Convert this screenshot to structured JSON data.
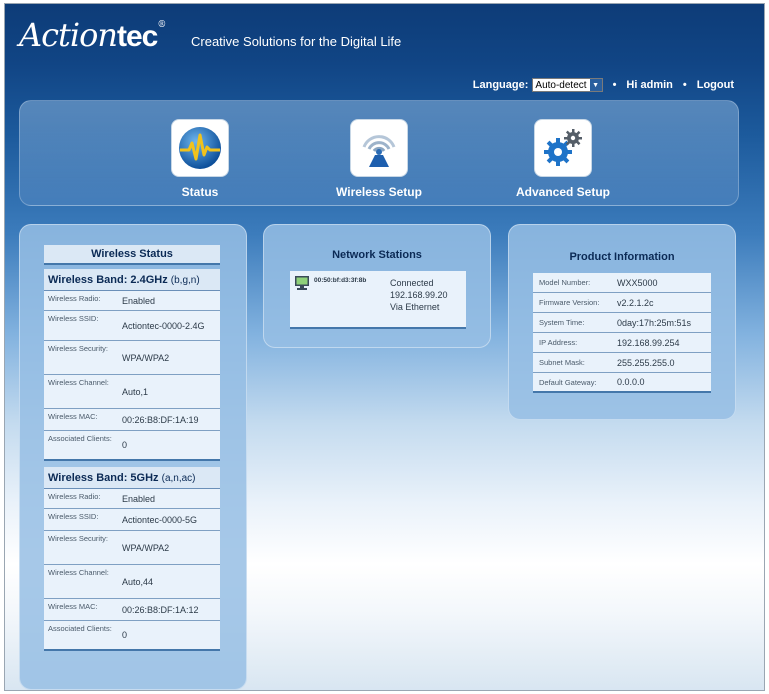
{
  "header": {
    "brand_script": "Action",
    "brand_bold": "tec",
    "trademark": "®",
    "tagline": "Creative Solutions for the Digital Life",
    "language_label": "Language:",
    "language_value": "Auto-detect",
    "greeting": "Hi admin",
    "logout_label": "Logout",
    "bullet": "•"
  },
  "nav": {
    "items": [
      {
        "label": "Status",
        "icon": "status-waveform-icon"
      },
      {
        "label": "Wireless Setup",
        "icon": "wireless-signal-icon"
      },
      {
        "label": "Advanced Setup",
        "icon": "gears-icon"
      }
    ]
  },
  "wireless_status": {
    "title": "Wireless Status",
    "bands": [
      {
        "name": "Wireless Band: 2.4GHz",
        "modes": "(b,g,n)",
        "rows": [
          {
            "key": "Wireless Radio:",
            "value": "Enabled"
          },
          {
            "key": "Wireless SSID:",
            "value": "Actiontec-0000-2.4G"
          },
          {
            "key": "Wireless Security:",
            "value": "WPA/WPA2"
          },
          {
            "key": "Wireless Channel:",
            "value": "Auto,1"
          },
          {
            "key": "Wireless MAC:",
            "value": "00:26:B8:DF:1A:19"
          },
          {
            "key": "Associated Clients:",
            "value": "0"
          }
        ]
      },
      {
        "name": "Wireless Band: 5GHz",
        "modes": "(a,n,ac)",
        "rows": [
          {
            "key": "Wireless Radio:",
            "value": "Enabled"
          },
          {
            "key": "Wireless SSID:",
            "value": "Actiontec-0000-5G"
          },
          {
            "key": "Wireless Security:",
            "value": "WPA/WPA2"
          },
          {
            "key": "Wireless Channel:",
            "value": "Auto,44"
          },
          {
            "key": "Wireless MAC:",
            "value": "00:26:B8:DF:1A:12"
          },
          {
            "key": "Associated Clients:",
            "value": "0"
          }
        ]
      }
    ]
  },
  "network_stations": {
    "title": "Network Stations",
    "stations": [
      {
        "mac": "00:50:bf:d3:3f:8b",
        "status": "Connected",
        "ip": "192.168.99.20",
        "via": "Via Ethernet"
      }
    ]
  },
  "product_info": {
    "title": "Product Information",
    "rows": [
      {
        "key": "Model Number:",
        "value": "WXX5000"
      },
      {
        "key": "Firmware Version:",
        "value": "v2.2.1.2c"
      },
      {
        "key": "System Time:",
        "value": "0day:17h:25m:51s"
      },
      {
        "key": "IP Address:",
        "value": "192.168.99.254"
      },
      {
        "key": "Subnet Mask:",
        "value": "255.255.255.0"
      },
      {
        "key": "Default Gateway:",
        "value": "0.0.0.0"
      }
    ]
  },
  "colors": {
    "header_bg": "#0d3c78",
    "panel_bg": "#96bee4",
    "row_bg": "#e9f2fb",
    "accent_line": "#4477aa"
  }
}
